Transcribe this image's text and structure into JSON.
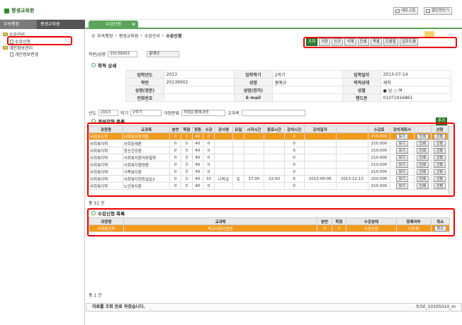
{
  "header": {
    "app_title": "평생교육원",
    "refresh_label": "새로고침",
    "close_all_label": "열린창닫기"
  },
  "sidebar": {
    "tabs": [
      "부속행정",
      "평생교육원"
    ],
    "tree": [
      {
        "label": "수강관리",
        "kind": "folder"
      },
      {
        "label": "수강신청",
        "kind": "doc"
      },
      {
        "label": "개인정보관리",
        "kind": "folder"
      },
      {
        "label": "개인정보변경",
        "kind": "doc"
      }
    ]
  },
  "content_tab": {
    "label": "수강신청"
  },
  "breadcrumb": {
    "items": [
      "부속행정",
      "평생교육원",
      "수강관리"
    ],
    "current": "수강신청"
  },
  "toolbar": {
    "buttons": [
      "조회",
      "저장",
      "신규",
      "삭제",
      "인쇄",
      "엑셀",
      "도움말",
      "업무도움"
    ]
  },
  "student_search": {
    "label": "학번/성명",
    "id": "20139002",
    "name": "홍예규"
  },
  "detail": {
    "title": "학적 상세",
    "rows": [
      [
        {
          "l": "입학년도",
          "v": "2013"
        },
        {
          "l": "입학학기",
          "v": "2학기"
        },
        {
          "l": "입학일자",
          "v": "2013-07-14"
        }
      ],
      [
        {
          "l": "학번",
          "v": "20139002"
        },
        {
          "l": "성명",
          "v": "홍예규"
        },
        {
          "l": "학적상태",
          "v": "재학"
        }
      ],
      [
        {
          "l": "성명(영문)",
          "v": ""
        },
        {
          "l": "성명(한자)",
          "v": ""
        },
        {
          "l": "성별",
          "v": "● 남   ○ 여"
        }
      ],
      [
        {
          "l": "전화번호",
          "v": ""
        },
        {
          "l": "E-mail",
          "v": ""
        },
        {
          "l": "핸드폰",
          "v": "01071916861"
        }
      ]
    ]
  },
  "filter": {
    "year_label": "년도",
    "year_value": "2013",
    "term_label": "학기",
    "term_value": "2학기",
    "category_label": "과정분류",
    "category_value": "학점은행제과정",
    "subject_label": "교과목",
    "subject_value": ""
  },
  "course_list": {
    "title": "개설강좌 목록",
    "add_label": "추가",
    "columns": [
      "과정명",
      "교과목",
      "분반",
      "학점",
      "정원",
      "수강",
      "강사명",
      "요일",
      "시작시간",
      "종료시간",
      "강의시간",
      "강의일자",
      "",
      "수강료",
      "강의계획서",
      "",
      "선청"
    ],
    "rows": [
      [
        "사회복지학",
        "사회복지정책론",
        "0",
        "3",
        "40",
        "0",
        "",
        "",
        "",
        "",
        "0",
        "",
        "",
        "210,000",
        "보기",
        "인쇄",
        "신청"
      ],
      [
        "사회복지학",
        "사회문제론",
        "0",
        "3",
        "40",
        "0",
        "",
        "",
        "",
        "",
        "0",
        "",
        "",
        "210,000",
        "보기",
        "인쇄",
        "신청"
      ],
      [
        "사회복지학",
        "정신건강론",
        "0",
        "3",
        "40",
        "0",
        "",
        "",
        "",
        "",
        "0",
        "",
        "",
        "210,000",
        "보기",
        "인쇄",
        "신청"
      ],
      [
        "사회복지학",
        "사회복지윤리와철학",
        "0",
        "3",
        "40",
        "0",
        "",
        "",
        "",
        "",
        "0",
        "",
        "",
        "210,000",
        "보기",
        "인쇄",
        "신청"
      ],
      [
        "사회복지학",
        "사회복지행정론",
        "0",
        "3",
        "40",
        "0",
        "",
        "",
        "",
        "",
        "0",
        "",
        "",
        "210,000",
        "보기",
        "인쇄",
        "신청"
      ],
      [
        "사회복지학",
        "가족복지론",
        "0",
        "3",
        "40",
        "0",
        "",
        "",
        "",
        "",
        "0",
        "",
        "",
        "210,000",
        "보기",
        "인쇄",
        "신청"
      ],
      [
        "사회복지학",
        "사회복지현장실습2",
        "0",
        "3",
        "40",
        "33",
        "나락금",
        "토",
        "17:00",
        "22:50",
        "6",
        "2013-09-06",
        "2013-12-13",
        "250,000",
        "보기",
        "인쇄",
        "신청"
      ],
      [
        "사회복지학",
        "노인복지론",
        "0",
        "3",
        "40",
        "0",
        "",
        "",
        "",
        "",
        "0",
        "",
        "",
        "210,000",
        "보기",
        "인쇄",
        "신청"
      ]
    ],
    "count_text": "총 51 건"
  },
  "applied_list": {
    "title": "수강신청 목록",
    "columns": [
      "과정명",
      "교과목",
      "분반",
      "학점",
      "수강상태",
      "등록여부",
      "취소"
    ],
    "rows": [
      [
        "사회복지학",
        "학교사회사업론",
        "0",
        "3",
        "수강신청",
        "미등록",
        "취소"
      ]
    ],
    "count_text": "총 1 건"
  },
  "status_bar": {
    "message": "자료를 조회 완료 하였습니다.",
    "screen_id": "fc50_10105010_m"
  }
}
